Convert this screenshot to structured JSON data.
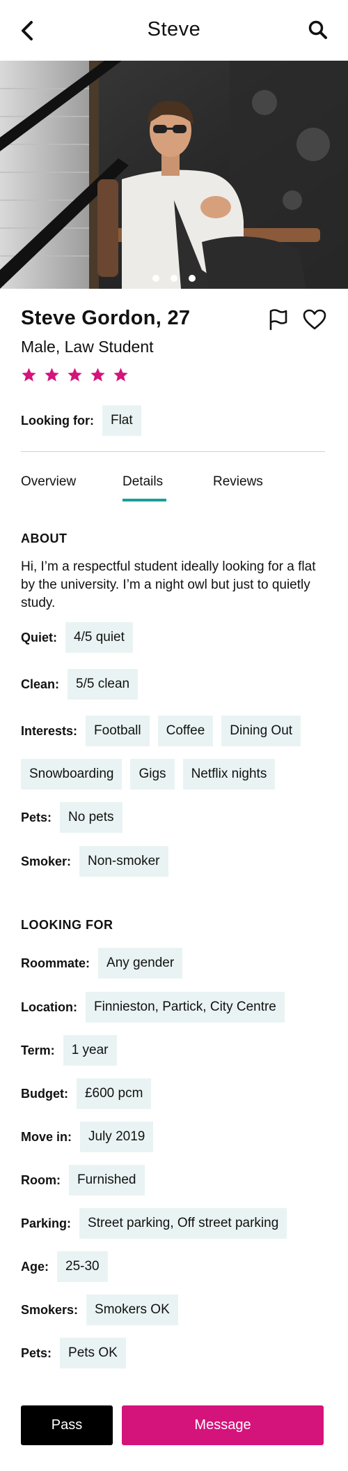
{
  "header": {
    "title": "Steve",
    "back_icon": "back-chevron-icon",
    "search_icon": "search-icon"
  },
  "gallery": {
    "photo_count": 3,
    "active_index": 1
  },
  "profile": {
    "name": "Steve Gordon, 27",
    "subtitle": "Male, Law Student",
    "rating": 5,
    "rating_max": 5,
    "star_color": "#d4137b",
    "looking_for_label": "Looking for:",
    "looking_for_value": "Flat"
  },
  "tabs": [
    {
      "label": "Overview"
    },
    {
      "label": "Details",
      "active": true
    },
    {
      "label": "Reviews"
    }
  ],
  "accent_color": "#17a098",
  "about": {
    "heading": "ABOUT",
    "text": "Hi, I’m a respectful student ideally looking for a flat by the university. I’m a night owl but just to quietly study.",
    "quiet_label": "Quiet:",
    "quiet_value": "4/5 quiet",
    "clean_label": "Clean:",
    "clean_value": "5/5 clean",
    "interests_label": "Interests:",
    "interests": [
      "Football",
      "Coffee",
      "Dining Out",
      "Snowboarding",
      "Gigs",
      "Netflix nights"
    ],
    "pets_label": "Pets:",
    "pets_value": "No pets",
    "smoker_label": "Smoker:",
    "smoker_value": "Non-smoker"
  },
  "looking_for": {
    "heading": "LOOKING FOR",
    "roommate_label": "Roommate:",
    "roommate_value": "Any gender",
    "location_label": "Location:",
    "location_value": "Finnieston, Partick, City Centre",
    "term_label": "Term:",
    "term_value": "1 year",
    "budget_label": "Budget:",
    "budget_value": "£600 pcm",
    "move_in_label": "Move in:",
    "move_in_value": "July 2019",
    "room_label": "Room:",
    "room_value": "Furnished",
    "parking_label": "Parking:",
    "parking_value": "Street parking, Off street parking",
    "age_label": "Age:",
    "age_value": "25-30",
    "smokers_label": "Smokers:",
    "smokers_value": "Smokers OK",
    "pets_label": "Pets:",
    "pets_value": "Pets OK"
  },
  "actions": {
    "pass_label": "Pass",
    "message_label": "Message",
    "message_color": "#d4137b"
  }
}
